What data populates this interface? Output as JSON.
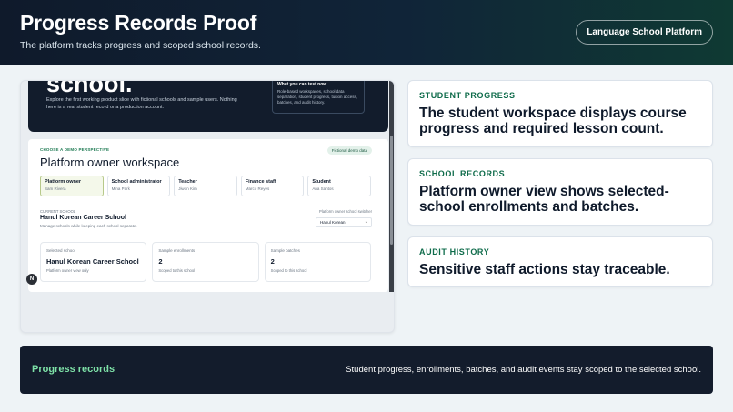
{
  "header": {
    "title": "Progress Records Proof",
    "subtitle": "The platform tracks progress and scoped school records.",
    "platform_button": "Language School Platform"
  },
  "screenshot": {
    "hero": {
      "heading": "school.",
      "description": "Explore the first working product slice with fictional schools and sample users. Nothing here is a real student record or a production account.",
      "test_title": "What you can test now",
      "test_desc": "Role-based workspaces, school data separation, student progress, tuition access, batches, and audit history."
    },
    "workspace": {
      "kicker": "CHOOSE A DEMO PERSPECTIVE",
      "title": "Platform owner workspace",
      "badge": "Fictional demo data",
      "roles": [
        {
          "name": "Platform owner",
          "person": "Sam Rivera"
        },
        {
          "name": "School administrator",
          "person": "Mina Park"
        },
        {
          "name": "Teacher",
          "person": "Jiwon Kim"
        },
        {
          "name": "Finance staff",
          "person": "Marco Reyes"
        },
        {
          "name": "Student",
          "person": "Ana Santos"
        }
      ],
      "current_school_label": "CURRENT SCHOOL",
      "current_school": "Hanul Korean Career School",
      "current_school_desc": "Manage schools while keeping each school separate.",
      "switcher_label": "Platform owner school switcher",
      "switcher_value": "Hanul Korean",
      "stats": [
        {
          "label": "Selected school",
          "value": "Hanul Korean Career School",
          "sub": "Platform owner view only"
        },
        {
          "label": "Sample enrollments",
          "value": "2",
          "sub": "Scoped to this school"
        },
        {
          "label": "Sample batches",
          "value": "2",
          "sub": "Scoped to this school"
        }
      ],
      "n_button": "N"
    }
  },
  "cards": [
    {
      "kicker": "STUDENT PROGRESS",
      "headline": "The student workspace displays course progress and required lesson count."
    },
    {
      "kicker": "SCHOOL RECORDS",
      "headline": "Platform owner view shows selected-school enrollments and batches."
    },
    {
      "kicker": "AUDIT HISTORY",
      "headline": "Sensitive staff actions stay traceable."
    }
  ],
  "footer": {
    "label": "Progress records",
    "text": "Student progress, enrollments, batches, and audit events stay scoped to the selected school."
  },
  "colors": {
    "accent_green": "#0e6b4a",
    "footer_green": "#7ee2a8",
    "dark_navy": "#131c2c"
  }
}
